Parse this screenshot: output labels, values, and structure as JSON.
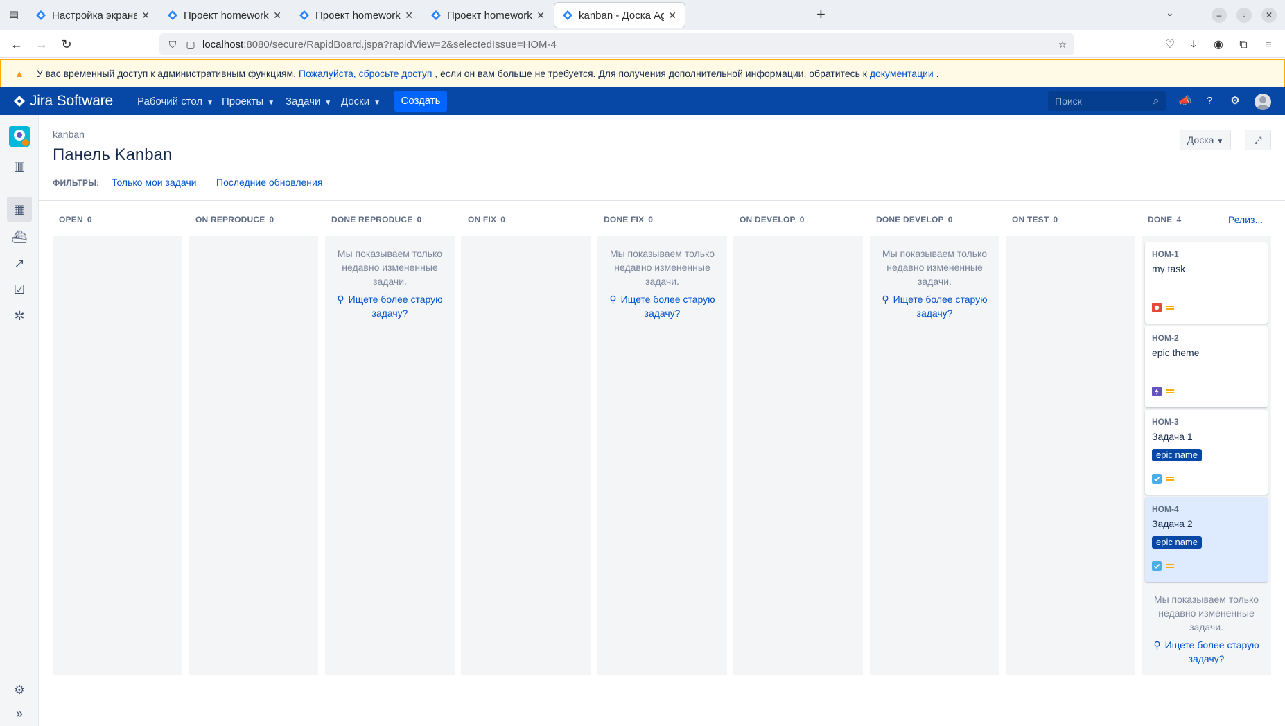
{
  "browser": {
    "tabs": [
      {
        "title": "Настройка экрана - Jira"
      },
      {
        "title": "Проект homework - Экр"
      },
      {
        "title": "Проект homework - Экр"
      },
      {
        "title": "Проект homework - Пол"
      },
      {
        "title": "kanban - Доска Agile - Jir"
      }
    ],
    "url_host": "localhost",
    "url_rest": ":8080/secure/RapidBoard.jspa?rapidView=2&selectedIssue=HOM-4"
  },
  "banner": {
    "text1": "У вас временный доступ к административным функциям.",
    "link1": "Пожалуйста, сбросьте доступ",
    "text2": ", если он вам больше не требуется. Для получения дополнительной информации, обратитесь к",
    "link2": "документации",
    "text3": "."
  },
  "header": {
    "logo": "Jira Software",
    "menu": [
      "Рабочий стол",
      "Проекты",
      "Задачи",
      "Доски"
    ],
    "create": "Создать",
    "search_placeholder": "Поиск"
  },
  "page": {
    "breadcrumb": "kanban",
    "title": "Панель Kanban",
    "filters_label": "ФИЛЬТРЫ:",
    "filters": [
      "Только мои задачи",
      "Последние обновления"
    ],
    "board_button": "Доска",
    "release_link": "Релиз..."
  },
  "board": {
    "columns": [
      {
        "name": "OPEN",
        "count": "0"
      },
      {
        "name": "ON REPRODUCE",
        "count": "0"
      },
      {
        "name": "DONE REPRODUCE",
        "count": "0"
      },
      {
        "name": "ON FIX",
        "count": "0"
      },
      {
        "name": "DONE FIX",
        "count": "0"
      },
      {
        "name": "ON DEVELOP",
        "count": "0"
      },
      {
        "name": "DONE DEVELOP",
        "count": "0"
      },
      {
        "name": "ON TEST",
        "count": "0"
      },
      {
        "name": "DONE",
        "count": "4"
      }
    ],
    "note_text": "Мы показываем только недавно измененные задачи.",
    "older_link": "Ищете более старую задачу?",
    "cards": [
      {
        "key": "HOM-1",
        "summary": "my task",
        "epic": "",
        "type_icon": "bug-icon",
        "priority": "medium-priority-icon"
      },
      {
        "key": "HOM-2",
        "summary": "epic theme",
        "epic": "",
        "type_icon": "epic-icon",
        "priority": "medium-priority-icon"
      },
      {
        "key": "HOM-3",
        "summary": "Задача 1",
        "epic": "epic name",
        "type_icon": "task-icon",
        "priority": "medium-priority-icon"
      },
      {
        "key": "HOM-4",
        "summary": "Задача 2",
        "epic": "epic name",
        "type_icon": "task-icon",
        "priority": "medium-priority-icon"
      }
    ]
  },
  "colors": {
    "header_bg": "#0747a6",
    "create_bg": "#0065ff",
    "epic_label_bg": "#0747a6",
    "bug": "#e5493a",
    "epic": "#6554c0",
    "task": "#4bade8",
    "priority_medium": "#ffab00"
  }
}
